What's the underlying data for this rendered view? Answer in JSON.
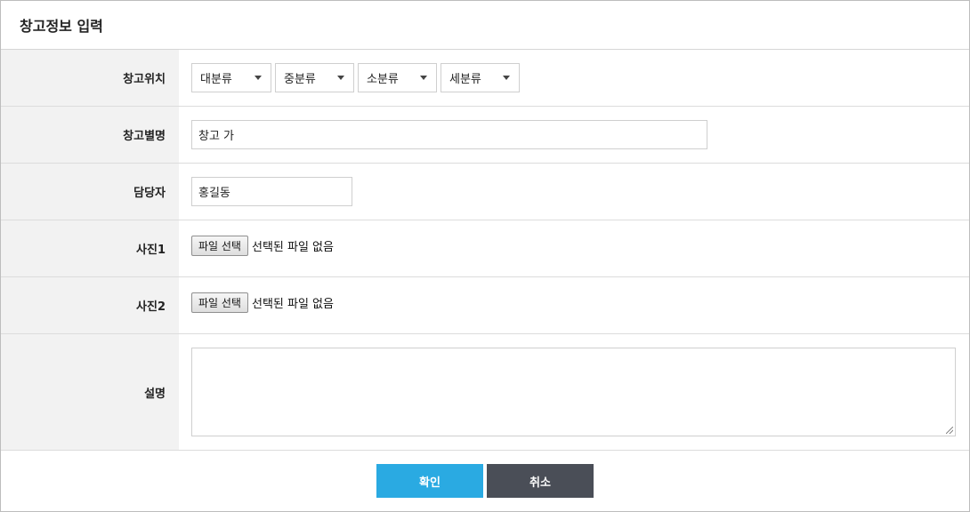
{
  "header": {
    "title": "창고정보 입력"
  },
  "location": {
    "label": "창고위치",
    "selects": [
      {
        "value": "대분류"
      },
      {
        "value": "중분류"
      },
      {
        "value": "소분류"
      },
      {
        "value": "세분류"
      }
    ]
  },
  "warehouse_name": {
    "label": "창고별명",
    "value": "창고 가"
  },
  "manager": {
    "label": "담당자",
    "value": "홍길동"
  },
  "photo1": {
    "label": "사진1",
    "button": "파일 선택",
    "status": "선택된 파일 없음"
  },
  "photo2": {
    "label": "사진2",
    "button": "파일 선택",
    "status": "선택된 파일 없음"
  },
  "description": {
    "label": "설명",
    "value": ""
  },
  "footer": {
    "confirm": "확인",
    "cancel": "취소"
  },
  "colors": {
    "confirm": "#2aaae2",
    "cancel": "#4a4e57",
    "label_bg": "#f2f2f2"
  }
}
